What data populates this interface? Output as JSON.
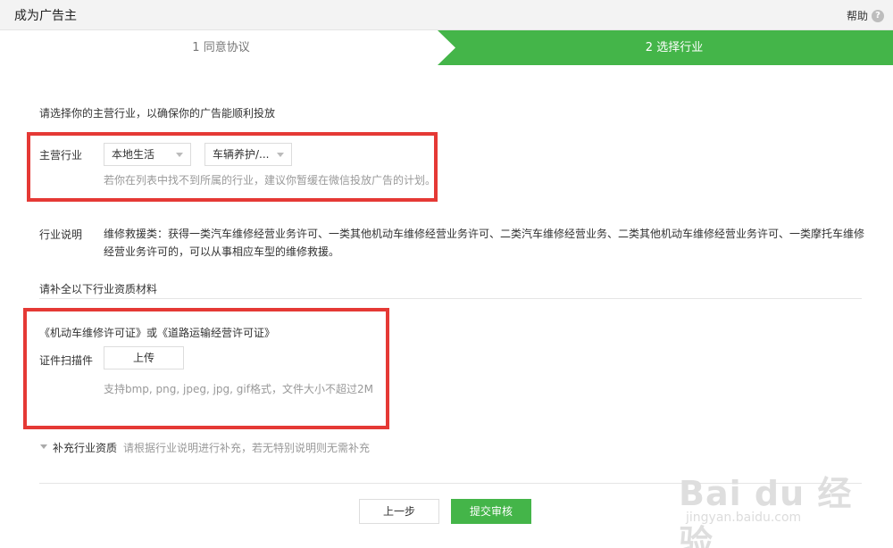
{
  "window": {
    "title": "成为广告主",
    "help_label": "帮助",
    "help_icon_glyph": "?"
  },
  "steps": [
    {
      "label": "1 同意协议",
      "active": false
    },
    {
      "label": "2 选择行业",
      "active": true
    }
  ],
  "colors": {
    "accent": "#44b549",
    "highlight_box": "#e53935"
  },
  "form": {
    "intro": "请选择你的主营行业，以确保你的广告能顺利投放",
    "industry_label": "主营行业",
    "select_primary": "本地生活",
    "select_secondary": "车辆养护/...",
    "industry_hint": "若你在列表中找不到所属的行业，建议你暂缓在微信投放广告的计划。",
    "desc_label": "行业说明",
    "desc_text": "维修救援类：获得一类汽车维修经营业务许可、一类其他机动车维修经营业务许可、二类汽车维修经营业务、二类其他机动车维修经营业务许可、一类摩托车维修经营业务许可的，可以从事相应车型的维修救援。",
    "qualification_title": "请补全以下行业资质材料",
    "license_name": "《机动车维修许可证》或《道路运输经营许可证》",
    "scan_label": "证件扫描件",
    "upload_label": "上传",
    "upload_hint": "支持bmp, png, jpeg, jpg, gif格式，文件大小不超过2M",
    "supplement_label": "补充行业资质",
    "supplement_hint": "请根据行业说明进行补充，若无特别说明则无需补充"
  },
  "actions": {
    "prev_label": "上一步",
    "submit_label": "提交审核"
  },
  "watermark": {
    "main": "Bai du 经验",
    "sub": "jingyan.baidu.com"
  }
}
